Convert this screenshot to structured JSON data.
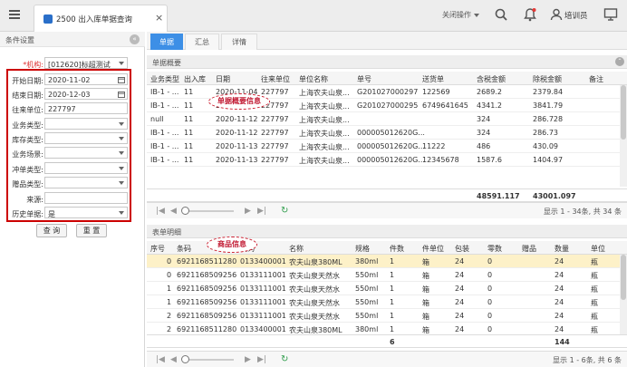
{
  "tab": {
    "title": "2500 出入库单据查询",
    "close": "×"
  },
  "topbar": {
    "close_action": "关闭操作",
    "user": "培训员"
  },
  "filter": {
    "title": "条件设置",
    "collapse": "«",
    "fields": [
      {
        "label": "*机构:",
        "value": "[012620]标超测试",
        "type": "select"
      },
      {
        "label": "开始日期:",
        "value": "2020-11-02",
        "type": "date"
      },
      {
        "label": "结束日期:",
        "value": "2020-12-03",
        "type": "date"
      },
      {
        "label": "往来单位:",
        "value": "227797",
        "type": "text"
      },
      {
        "label": "业务类型:",
        "value": "",
        "type": "select"
      },
      {
        "label": "库存类型:",
        "value": "",
        "type": "select"
      },
      {
        "label": "业务场景:",
        "value": "",
        "type": "select"
      },
      {
        "label": "冲单类型:",
        "value": "",
        "type": "select"
      },
      {
        "label": "赠品类型:",
        "value": "",
        "type": "select"
      },
      {
        "label": "来源:",
        "value": "",
        "type": "text"
      },
      {
        "label": "历史单据:",
        "value": "是",
        "type": "select"
      }
    ],
    "query_button": "查 询",
    "reset_button": "重 置"
  },
  "content_tabs": [
    "单据",
    "汇总",
    "详情"
  ],
  "summary": {
    "section_title": "单据概要",
    "callout": "单据概要信息",
    "columns": [
      "业务类型",
      "出入库",
      "日期",
      "往来单位",
      "单位名称",
      "单号",
      "送货单",
      "含税金额",
      "除税金额",
      "备注"
    ],
    "rows": [
      [
        "IB-1 - ...",
        "11",
        "2020-11-04",
        "227797",
        "上海农夫山泉...",
        "G201027000297",
        "122569",
        "2689.2",
        "2379.84",
        ""
      ],
      [
        "IB-1 - ...",
        "11",
        "2020-11-04",
        "227797",
        "上海农夫山泉...",
        "G201027000295",
        "6749641645",
        "4341.2",
        "3841.79",
        ""
      ],
      [
        "null",
        "11",
        "2020-11-12",
        "227797",
        "上海农夫山泉...",
        "",
        "",
        "324",
        "286.728",
        ""
      ],
      [
        "IB-1 - ...",
        "11",
        "2020-11-12",
        "227797",
        "上海农夫山泉...",
        "000005012620G...",
        "",
        "324",
        "286.73",
        ""
      ],
      [
        "IB-1 - ...",
        "11",
        "2020-11-13",
        "227797",
        "上海农夫山泉...",
        "000005012620G...",
        "11222",
        "486",
        "430.09",
        ""
      ],
      [
        "IB-1 - ...",
        "11",
        "2020-11-13",
        "227797",
        "上海农夫山泉...",
        "000005012620G...",
        "12345678",
        "1587.6",
        "1404.97",
        ""
      ]
    ],
    "total_tax": "48591.117",
    "total_notax": "43001.097",
    "pager": "显示 1 - 34条, 共 34 条"
  },
  "detail": {
    "section_title": "表单明细",
    "callout": "商品信息",
    "columns": [
      "序号",
      "条码",
      "编码",
      "名称",
      "规格",
      "件数",
      "件单位",
      "包装",
      "零数",
      "赠品",
      "数量",
      "单位"
    ],
    "rows": [
      [
        "0",
        "6921168511280",
        "0133400001",
        "农夫山泉380ML",
        "380ml",
        "1",
        "箱",
        "24",
        "0",
        "",
        "24",
        "瓶"
      ],
      [
        "0",
        "6921168509256",
        "0133111001",
        "农夫山泉天然水",
        "550ml",
        "1",
        "箱",
        "24",
        "0",
        "",
        "24",
        "瓶"
      ],
      [
        "1",
        "6921168509256",
        "0133111001",
        "农夫山泉天然水",
        "550ml",
        "1",
        "箱",
        "24",
        "0",
        "",
        "24",
        "瓶"
      ],
      [
        "1",
        "6921168509256",
        "0133111001",
        "农夫山泉天然水",
        "550ml",
        "1",
        "箱",
        "24",
        "0",
        "",
        "24",
        "瓶"
      ],
      [
        "2",
        "6921168509256",
        "0133111001",
        "农夫山泉天然水",
        "550ml",
        "1",
        "箱",
        "24",
        "0",
        "",
        "24",
        "瓶"
      ],
      [
        "2",
        "6921168511280",
        "0133400001",
        "农夫山泉380ML",
        "380ml",
        "1",
        "箱",
        "24",
        "0",
        "",
        "24",
        "瓶"
      ]
    ],
    "total_count": "6",
    "total_qty": "144",
    "pager": "显示 1 - 6条, 共 6 条"
  }
}
